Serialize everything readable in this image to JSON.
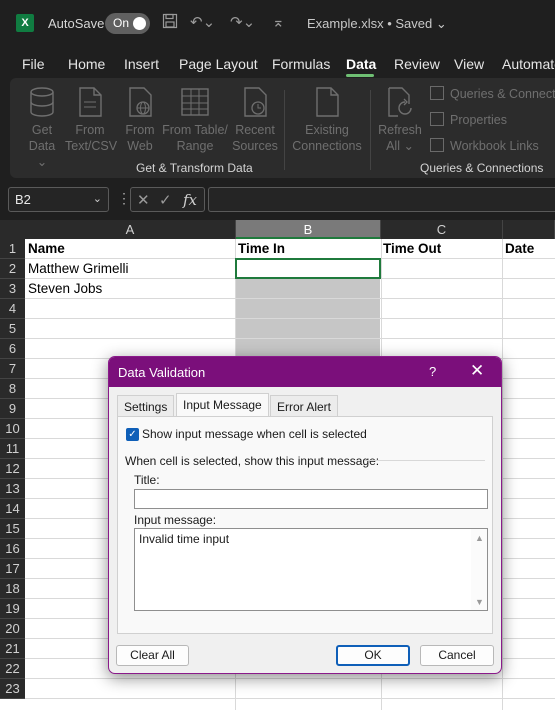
{
  "app": {
    "autosave_label": "AutoSave",
    "autosave_state": "On",
    "file_title": "Example.xlsx • Saved ⌄"
  },
  "menu": [
    "File",
    "Home",
    "Insert",
    "Page Layout",
    "Formulas",
    "Data",
    "Review",
    "View",
    "Automate"
  ],
  "active_menu": "Data",
  "ribbon": {
    "buttons": [
      {
        "label1": "Get",
        "label2": "Data ⌄"
      },
      {
        "label1": "From",
        "label2": "Text/CSV"
      },
      {
        "label1": "From",
        "label2": "Web"
      },
      {
        "label1": "From Table/",
        "label2": "Range"
      },
      {
        "label1": "Recent",
        "label2": "Sources"
      },
      {
        "label1": "Existing",
        "label2": "Connections"
      },
      {
        "label1": "Refresh",
        "label2": "All ⌄"
      }
    ],
    "queries_items": [
      "Queries & Connections",
      "Properties",
      "Workbook Links"
    ],
    "group_get_transform": "Get & Transform Data",
    "group_queries": "Queries & Connections"
  },
  "formula_bar": {
    "name_box": "B2",
    "dots": "⋮",
    "cancel_icon": "✕",
    "enter_icon": "✓",
    "fx_icon": "fx",
    "formula": ""
  },
  "sheet": {
    "columns": [
      "A",
      "B",
      "C"
    ],
    "rows": [
      "1",
      "2",
      "3",
      "4",
      "5",
      "6",
      "7",
      "8",
      "9",
      "10",
      "11",
      "12",
      "13",
      "14",
      "15",
      "16",
      "17",
      "18",
      "19",
      "20",
      "21",
      "22",
      "23"
    ],
    "headers": [
      "Name",
      "Time In",
      "Time Out",
      "Date"
    ],
    "names": [
      "Matthew Grimelli",
      "Steven Jobs"
    ],
    "selected_column": "B"
  },
  "dialog": {
    "title": "Data Validation",
    "help": "?",
    "close": "✕",
    "tabs": [
      "Settings",
      "Input Message",
      "Error Alert"
    ],
    "active_tab": "Input Message",
    "show_message_checked": true,
    "show_message_label": "Show input message when cell is selected",
    "section_label": "When cell is selected, show this input message:",
    "title_field_label": "Title:",
    "title_value": "",
    "message_field_label": "Input message:",
    "message_value": "Invalid time input",
    "buttons": {
      "clear_all": "Clear All",
      "ok": "OK",
      "cancel": "Cancel"
    }
  }
}
